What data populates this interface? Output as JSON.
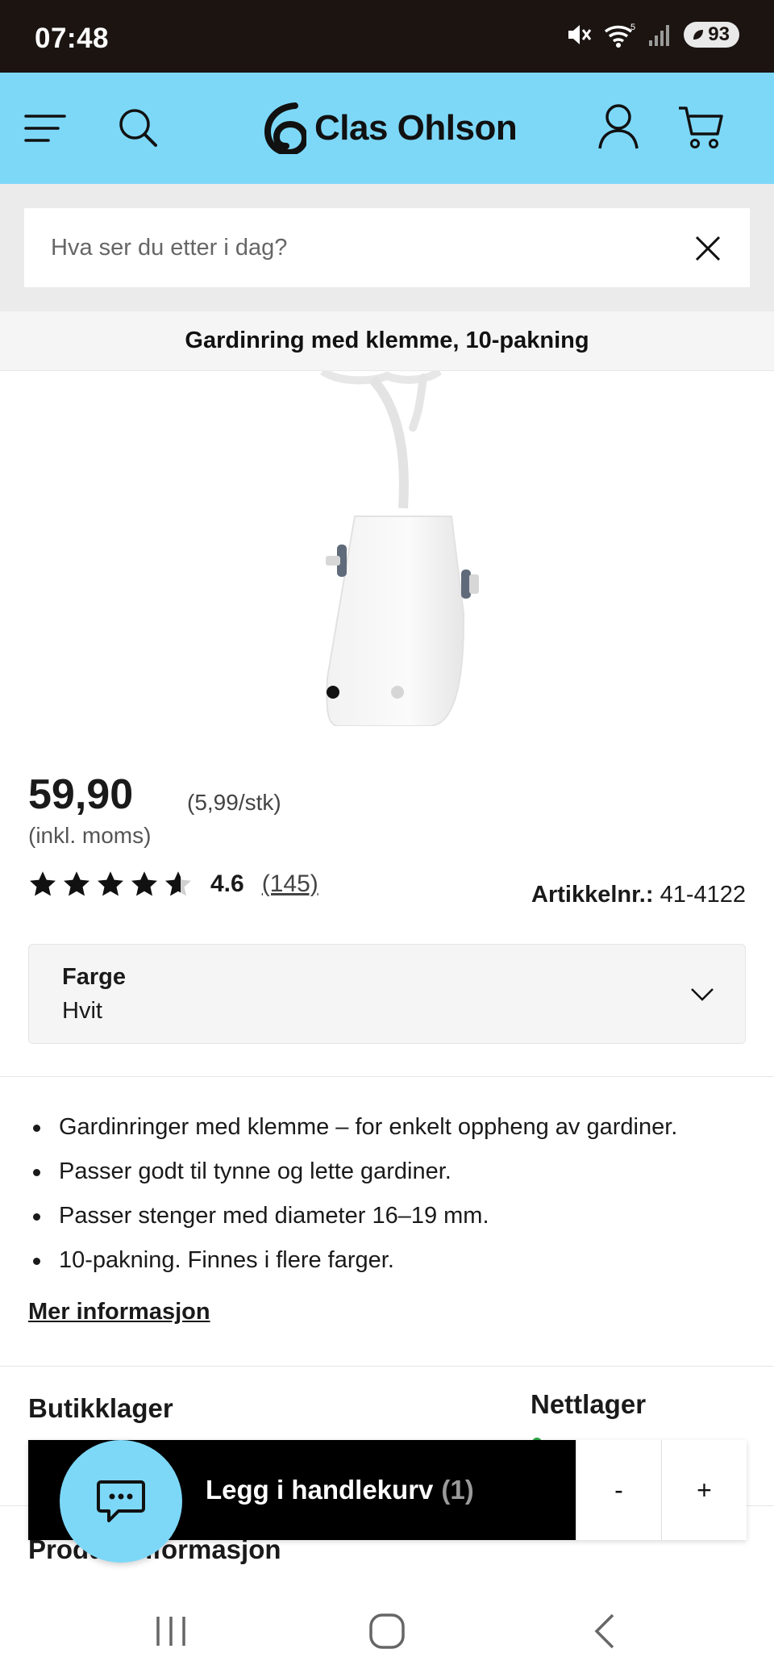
{
  "status_bar": {
    "time": "07:48",
    "battery": "93",
    "icons": [
      "mute-icon",
      "wifi-icon",
      "signal-icon",
      "battery-icon"
    ]
  },
  "header": {
    "brand": "Clas Ohlson",
    "icons": [
      "menu-icon",
      "search-icon",
      "account-icon",
      "cart-icon"
    ],
    "accent_color": "#7dd8f8"
  },
  "search": {
    "placeholder": "Hva ser du etter i dag?",
    "value": ""
  },
  "product": {
    "title": "Gardinring med klemme, 10-pakning",
    "price": "59,90",
    "unit_price": "(5,99/stk)",
    "vat_note": "(inkl. moms)",
    "rating": "4.6",
    "rating_stars": 4.6,
    "review_count": "(145)",
    "article_label": "Artikkelnr.:",
    "article_number": "41-4122",
    "image_count": 2,
    "active_image": 1
  },
  "color_select": {
    "label": "Farge",
    "value": "Hvit"
  },
  "features": [
    "Gardinringer med klemme – for enkelt oppheng av gardiner.",
    "Passer godt til tynne og lette gardiner.",
    "Passer stenger med diameter 16–19 mm.",
    "10-pakning. Finnes i flere farger."
  ],
  "more_info": "Mer informasjon",
  "stock": {
    "store": "Butikklager",
    "online": "Nettlager"
  },
  "section_heading": "Produktinformasjon",
  "cart_bar": {
    "add_label": "Legg i handlekurv",
    "qty": "(1)",
    "minus": "-",
    "plus": "+"
  }
}
